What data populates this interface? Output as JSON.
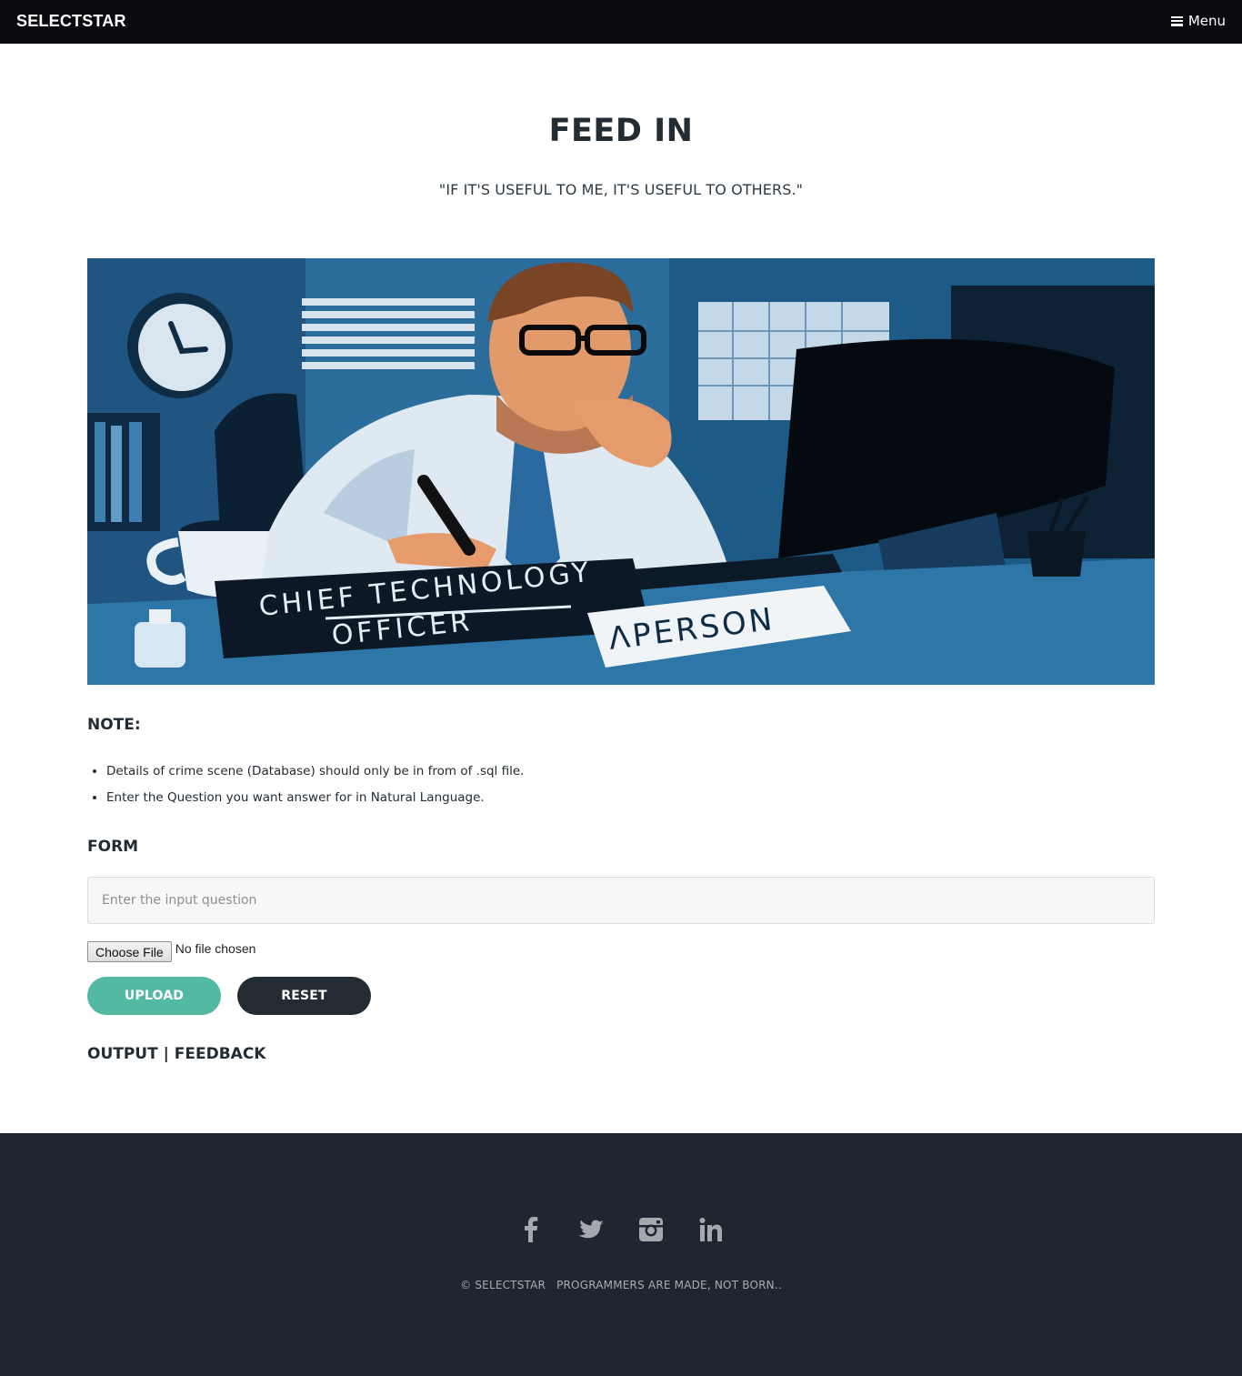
{
  "navbar": {
    "brand": "SELECTSTAR",
    "menu_label": "Menu"
  },
  "hero": {
    "title": "FEED IN",
    "subtitle": "\"IF IT'S USEFUL TO ME, IT'S USEFUL TO OTHERS.\""
  },
  "illustration": {
    "desk_sign_text": "CHIEF TECHNOLOGY",
    "desk_sign_struck": "OFFICER",
    "name_plate": "ΛPERSON"
  },
  "note": {
    "title": "NOTE:",
    "items": [
      "Details of crime scene (Database) should only be in from of .sql file.",
      "Enter the Question you want answer for in Natural Language."
    ]
  },
  "form": {
    "title": "FORM",
    "question_placeholder": "Enter the input question",
    "choose_file_label": "Choose File",
    "no_file_label": "No file chosen",
    "upload_label": "UPLOAD",
    "reset_label": "RESET"
  },
  "output": {
    "title": "OUTPUT | FEEDBACK"
  },
  "footer": {
    "social_icons": [
      "facebook-icon",
      "twitter-icon",
      "instagram-icon",
      "linkedin-icon"
    ],
    "copyright": "© SELECTSTAR",
    "tagline": "PROGRAMMERS ARE MADE, NOT BORN.."
  },
  "colors": {
    "navbar_bg": "#0a0b0f",
    "accent": "#53b9a3",
    "dark": "#232c33",
    "footer_bg": "#1f2630"
  }
}
